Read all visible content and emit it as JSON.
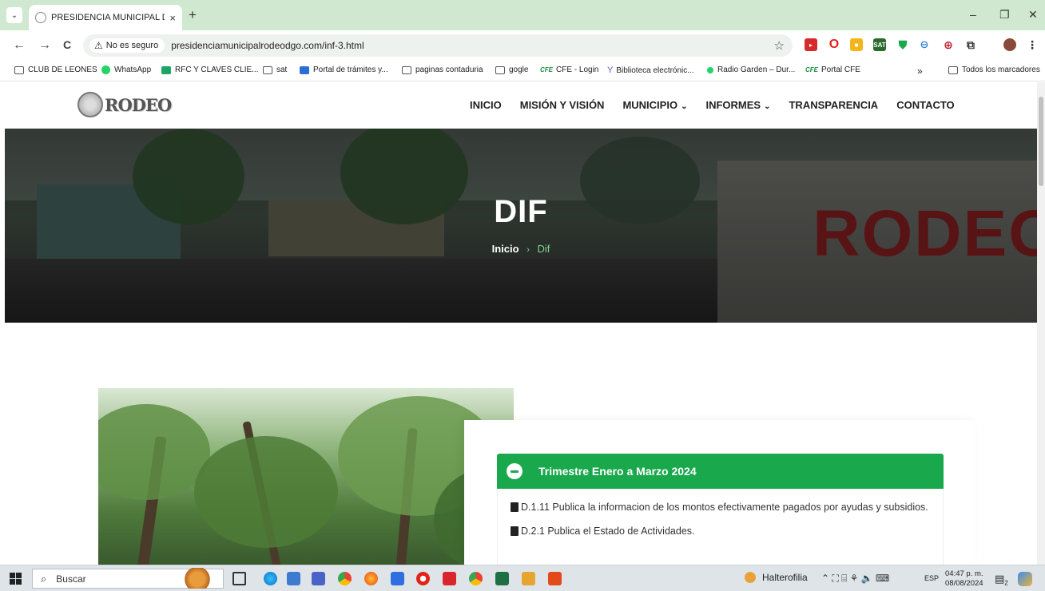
{
  "browser": {
    "tab_title": "PRESIDENCIA MUNICIPAL DE R",
    "tab_close": "×",
    "new_tab": "+",
    "tab_list": "⌄",
    "window_controls": {
      "minimize": "–",
      "restore": "❐",
      "close": "✕"
    },
    "nav": {
      "back": "←",
      "forward": "→",
      "reload": "C"
    },
    "security_label": "No es seguro",
    "url": "presidenciamunicipalrodeodgo.com/inf-3.html",
    "bookmarks": [
      {
        "label": "CLUB DE LEONES",
        "icon": "folder-icon"
      },
      {
        "label": "WhatsApp",
        "icon": "whatsapp-icon"
      },
      {
        "label": "RFC Y CLAVES CLIE...",
        "icon": "sheets-icon"
      },
      {
        "label": "sat",
        "icon": "folder-icon"
      },
      {
        "label": "Portal de trámites y...",
        "icon": "dropbox-icon"
      },
      {
        "label": "paginas contaduria",
        "icon": "folder-icon"
      },
      {
        "label": "gogle",
        "icon": "folder-icon"
      },
      {
        "label": "CFE - Login",
        "icon": "cfe-icon"
      },
      {
        "label": "Biblioteca electrónic...",
        "icon": "library-icon"
      },
      {
        "label": "Radio Garden – Dur...",
        "icon": "radio-garden-icon"
      },
      {
        "label": "Portal CFE",
        "icon": "cfe-icon"
      }
    ],
    "bookmarks_overflow": "»",
    "all_bookmarks": "Todos los marcadores",
    "cfe_tag": "CFE"
  },
  "site": {
    "logo_text": "RODEO",
    "nav": [
      {
        "label": "INICIO",
        "dropdown": false
      },
      {
        "label": "MISIÓN Y VISIÓN",
        "dropdown": false
      },
      {
        "label": "MUNICIPIO",
        "dropdown": true
      },
      {
        "label": "INFORMES",
        "dropdown": true
      },
      {
        "label": "TRANSPARENCIA",
        "dropdown": false
      },
      {
        "label": "CONTACTO",
        "dropdown": false
      }
    ],
    "hero": {
      "title": "DIF",
      "breadcrumb_home": "Inicio",
      "breadcrumb_sep": "›",
      "breadcrumb_current": "Dif",
      "sign_text": "RODEO"
    },
    "accordion": {
      "title": "Trimestre Enero a Marzo 2024",
      "items": [
        "D.1.11 Publica la informacion de los montos efectivamente pagados por ayudas y subsidios.",
        "D.2.1 Publica el Estado de Actividades."
      ]
    },
    "accent_color": "#1aa84d"
  },
  "taskbar": {
    "search_placeholder": "Buscar",
    "weather_label": "Halterofilia",
    "tray_icons": "⌃ ⛶ ⌸ ⚘ 🔈 ⌨",
    "language": "ESP",
    "time": "04:47 p. m.",
    "date": "08/08/2024",
    "notification_count": "2"
  }
}
